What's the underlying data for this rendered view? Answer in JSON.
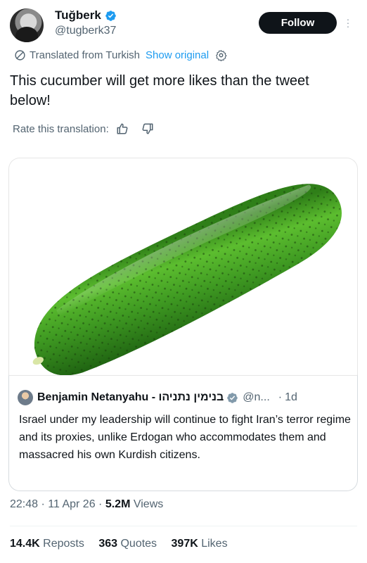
{
  "author": {
    "display_name": "Tuğberk",
    "handle": "@tugberk37",
    "follow_label": "Follow"
  },
  "translation": {
    "notice": "Translated from Turkish",
    "show_original": "Show original",
    "rate_label": "Rate this translation:"
  },
  "tweet": {
    "text": "This cucumber will get more likes than the tweet below!"
  },
  "quoted": {
    "name": "Benjamin Netanyahu - בנימין נתניהו",
    "handle": "@n...",
    "separator": "·",
    "time": "1d",
    "text": "Israel under my leadership will continue to fight Iran’s terror regime and its proxies, unlike Erdogan who accommodates them and massacred his own Kurdish citizens."
  },
  "meta": {
    "time": "22:48",
    "dot1": "·",
    "date": "11 Apr 26",
    "dot2": "·",
    "views_count": "5.2M",
    "views_label": "Views"
  },
  "stats": {
    "reposts_count": "14.4K",
    "reposts_label": "Reposts",
    "quotes_count": "363",
    "quotes_label": "Quotes",
    "likes_count": "397K",
    "likes_label": "Likes"
  },
  "colors": {
    "accent": "#1d9bf0",
    "text": "#0f1419",
    "muted": "#536471",
    "cucumber_dark": "#1f6b14",
    "cucumber_light": "#5bbd2c"
  },
  "icons": {
    "verified": "verified-badge-icon",
    "translate": "translate-icon",
    "settings": "gear-icon",
    "like": "thumbs-up-icon",
    "dislike": "thumbs-down-icon",
    "more": "more-vertical-icon"
  }
}
